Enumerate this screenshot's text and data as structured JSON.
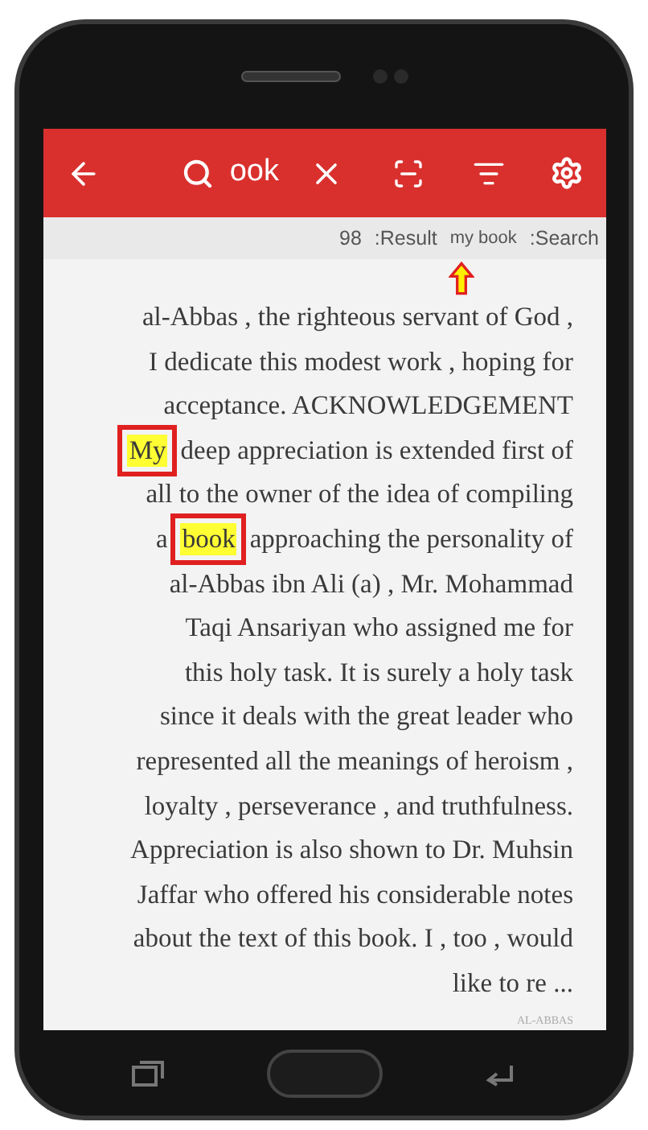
{
  "toolbar": {
    "search_query": "ook"
  },
  "result_bar": {
    "count": "98",
    "result_label": ":Result",
    "search_term": "my book",
    "search_label": ":Search"
  },
  "lines": [
    {
      "kind": "plain",
      "text": "al-Abbas , the righteous servant of God ,"
    },
    {
      "kind": "plain",
      "text": "I dedicate this modest work , hoping for"
    },
    {
      "kind": "plain",
      "text": "acceptance. ACKNOWLEDGEMENT"
    },
    {
      "kind": "match",
      "match": "My",
      "after": "deep appreciation is extended first of"
    },
    {
      "kind": "plain",
      "text": "all to the owner of the idea of compiling"
    },
    {
      "kind": "match",
      "before": "a",
      "match": "book",
      "after": "approaching the personality of"
    },
    {
      "kind": "plain",
      "text": "al-Abbas ibn Ali (a) , Mr. Mohammad"
    },
    {
      "kind": "plain",
      "text": "Taqi Ansariyan who assigned me for"
    },
    {
      "kind": "plain",
      "text": "this holy task. It is surely a holy task"
    },
    {
      "kind": "plain",
      "text": "since it deals with the great leader who"
    },
    {
      "kind": "plain",
      "text": "represented all the meanings of heroism ,"
    },
    {
      "kind": "plain",
      "text": "loyalty , perseverance , and truthfulness."
    },
    {
      "kind": "plain",
      "text": "Appreciation is also shown to Dr. Muhsin"
    },
    {
      "kind": "plain",
      "text": "Jaffar who offered his considerable notes"
    },
    {
      "kind": "plain",
      "text": "about the text of this book. I , too , would"
    },
    {
      "kind": "plain",
      "text": "like to re ..."
    }
  ],
  "page_footer": "AL-ABBAS"
}
